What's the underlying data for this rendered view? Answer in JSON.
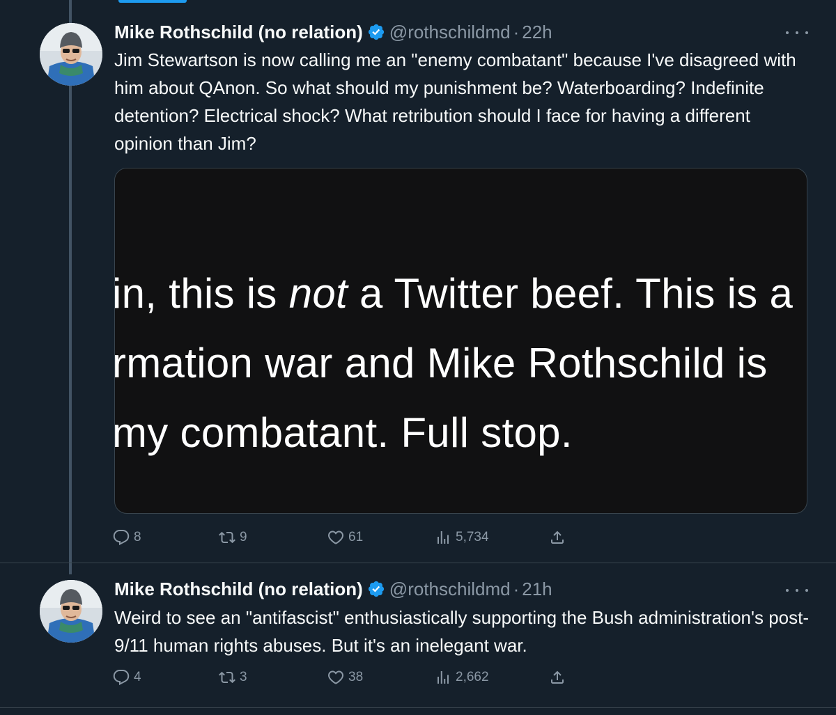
{
  "colors": {
    "background": "#15202b",
    "accent": "#1d9bf0",
    "secondary_text": "#8b98a5",
    "primary_text": "#f7f9f9",
    "divider": "#38444d"
  },
  "tweets": [
    {
      "display_name": "Mike Rothschild (no relation)",
      "handle": "@rothschildmd",
      "separator": "·",
      "time": "22h",
      "verified_icon": "verified-badge-icon",
      "text": "Jim Stewartson is now calling me an \"enemy combatant\" because I've disagreed with him about QAnon. So what should my punishment be? Waterboarding? Indefinite detention? Electrical shock? What retribution should I face for having a different opinion than Jim?",
      "media_lines": [
        {
          "before": "in, this is ",
          "emph": "not",
          "after": " a Twitter beef. This is a"
        },
        {
          "before": "rmation war and Mike Rothschild is",
          "emph": "",
          "after": ""
        },
        {
          "before": "my combatant. Full stop.",
          "emph": "",
          "after": ""
        }
      ],
      "replies": "8",
      "retweets": "9",
      "likes": "61",
      "views": "5,734"
    },
    {
      "display_name": "Mike Rothschild (no relation)",
      "handle": "@rothschildmd",
      "separator": "·",
      "time": "21h",
      "verified_icon": "verified-badge-icon",
      "text": "Weird to see an \"antifascist\" enthusiastically supporting the Bush administration's post-9/11 human rights abuses. But it's an inelegant war.",
      "replies": "4",
      "retweets": "3",
      "likes": "38",
      "views": "2,662"
    }
  ]
}
